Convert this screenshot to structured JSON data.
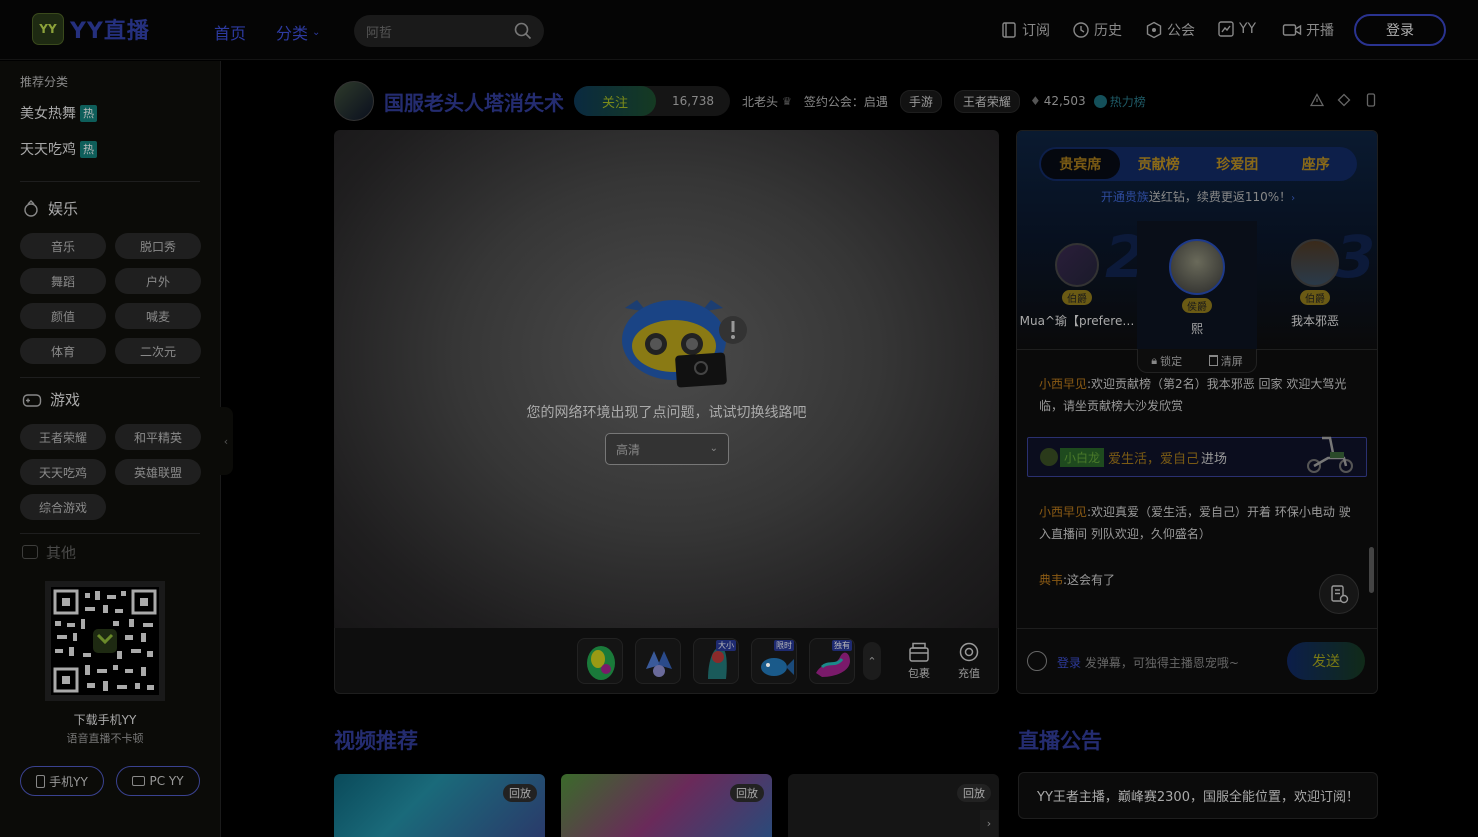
{
  "header": {
    "logo_badge": "YY",
    "logo_text": "YY直播",
    "nav_home": "首页",
    "nav_category": "分类",
    "search_placeholder": "阿哲",
    "subscribe": "订阅",
    "history": "历史",
    "guild": "公会",
    "yy": "YY",
    "start_live": "开播",
    "login": "登录"
  },
  "sidebar": {
    "recommend_title": "推荐分类",
    "hot_items": [
      {
        "label": "美女热舞",
        "badge": "热"
      },
      {
        "label": "天天吃鸡",
        "badge": "热"
      }
    ],
    "entertainment": {
      "title": "娱乐",
      "chips": [
        "音乐",
        "脱口秀",
        "舞蹈",
        "户外",
        "颜值",
        "喊麦",
        "体育",
        "二次元"
      ]
    },
    "games": {
      "title": "游戏",
      "chips": [
        "王者荣耀",
        "和平精英",
        "天天吃鸡",
        "英雄联盟",
        "综合游戏"
      ]
    },
    "others_title": "其他",
    "qr_caption": "下载手机YY",
    "qr_sub": "语音直播不卡顿",
    "mobile_yy": "手机YY",
    "pc_yy": "PC YY"
  },
  "stream": {
    "title": "国服老头人塔消失术",
    "follow": "关注",
    "follow_count": "16,738",
    "host": "北老头",
    "guild_label": "签约公会：启遇",
    "tags": [
      "手游",
      "王者荣耀"
    ],
    "heat": "42,503",
    "hot_list": "热力榜",
    "error_msg": "您的网络环境出现了点问题，试试切换线路吧",
    "line_select": "高清"
  },
  "gifts": [
    {
      "label": ""
    },
    {
      "label": ""
    },
    {
      "label": "大小"
    },
    {
      "label": "限时"
    },
    {
      "label": "独有"
    }
  ],
  "gift_buttons": {
    "bag": "包裹",
    "recharge": "充值"
  },
  "panel": {
    "tabs": [
      "贵宾席",
      "贡献榜",
      "珍爱团",
      "座序"
    ],
    "promo_prefix": "开通",
    "promo_link": "贵族",
    "promo_text": "送红钻，续费更返110%！",
    "ranks": [
      {
        "num": "2",
        "name": "Mua^瑜【prefere…",
        "level": "伯爵"
      },
      {
        "num": "1",
        "name": "熙",
        "level": "侯爵"
      },
      {
        "num": "3",
        "name": "我本邪恶",
        "level": "伯爵"
      }
    ],
    "lock": "锁定",
    "clear": "清屏",
    "chat": [
      {
        "user": "小西早见",
        "text": ":欢迎贡献榜（第2名）我本邪恶 回家 欢迎大驾光临，请坐贡献榜大沙发欣赏"
      },
      {
        "user": "小西早见",
        "text": ":欢迎真爱（爱生活，爱自己）开着 环保小电动 驶入直播间 列队欢迎，久仰盛名）"
      },
      {
        "user": "典韦",
        "text": ":这会有了"
      }
    ],
    "banner_tag": "小白龙",
    "banner_text": "爱生活，爱自己",
    "banner_suffix": "进场",
    "input_login": "登录",
    "input_placeholder": "发弹幕，可独得主播恩宠哦~",
    "send": "发送"
  },
  "sections": {
    "video_title": "视频推荐",
    "notice_title": "直播公告",
    "notice_text": "YY王者主播，巅峰赛2300，国服全能位置，欢迎订阅！",
    "replay": "回放"
  },
  "colors": {
    "brand_blue": "#242c70",
    "gold": "#7a5a14",
    "hot_teal": "#0e5e5a"
  }
}
